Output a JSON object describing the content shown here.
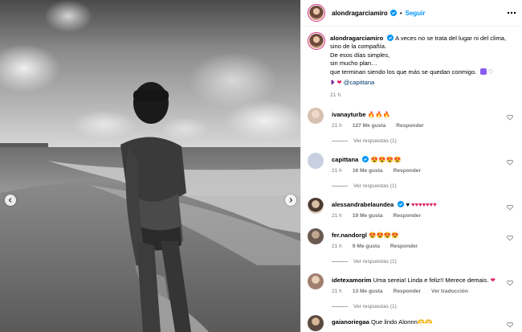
{
  "header": {
    "username": "alondragarciamiro",
    "separator": "•",
    "follow_label": "Seguir"
  },
  "caption": {
    "username": "alondragarciamiro",
    "lines": [
      "A veces no se trata del lugar ni del clima,",
      "sino de la compañía.",
      "De esos días simples,",
      "sin mucho plan…",
      "que terminan siendo los que más se quedan conmigo."
    ],
    "mention": "@capittana",
    "time": "21 h"
  },
  "comments": [
    {
      "username": "ivanayturbe",
      "text": "🔥🔥🔥",
      "time": "21 h",
      "likes": "127 Me gusta",
      "reply": "Responder",
      "view_replies": "Ver respuestas (1)"
    },
    {
      "username": "capittana",
      "text": "😍😍😍😍",
      "time": "21 h",
      "likes": "16 Me gusta",
      "reply": "Responder",
      "view_replies": "Ver respuestas (1)"
    },
    {
      "username": "alessandrabelaundea",
      "text": "♥♥♥♥♥♥♥",
      "time": "21 h",
      "likes": "19 Me gusta",
      "reply": "Responder",
      "view_replies": ""
    },
    {
      "username": "fer.nandorgl",
      "text": "😍😍😍😍",
      "time": "21 h",
      "likes": "9 Me gusta",
      "reply": "Responder",
      "view_replies": "Ver respuestas (1)"
    },
    {
      "username": "idetexamorim",
      "text": "Uma sereia! Linda e feliz!! Merece demais.",
      "time": "21 h",
      "likes": "13 Me gusta",
      "reply": "Responder",
      "translate": "Ver traducción",
      "view_replies": "Ver respuestas (1)"
    },
    {
      "username": "gaianoriegaa",
      "text": "Que lindo Alonnn🫶🫶",
      "time": "",
      "likes": "",
      "reply": "",
      "view_replies": ""
    }
  ],
  "colors": {
    "accent": "#0095f6",
    "verified": "#0095f6",
    "heart": "#e0245e",
    "secondary_text": "#737373"
  },
  "icons": {
    "verified": "verified-badge-icon",
    "more": "more-options-icon",
    "like": "heart-outline-icon",
    "prev": "chevron-left-icon",
    "next": "chevron-right-icon"
  }
}
